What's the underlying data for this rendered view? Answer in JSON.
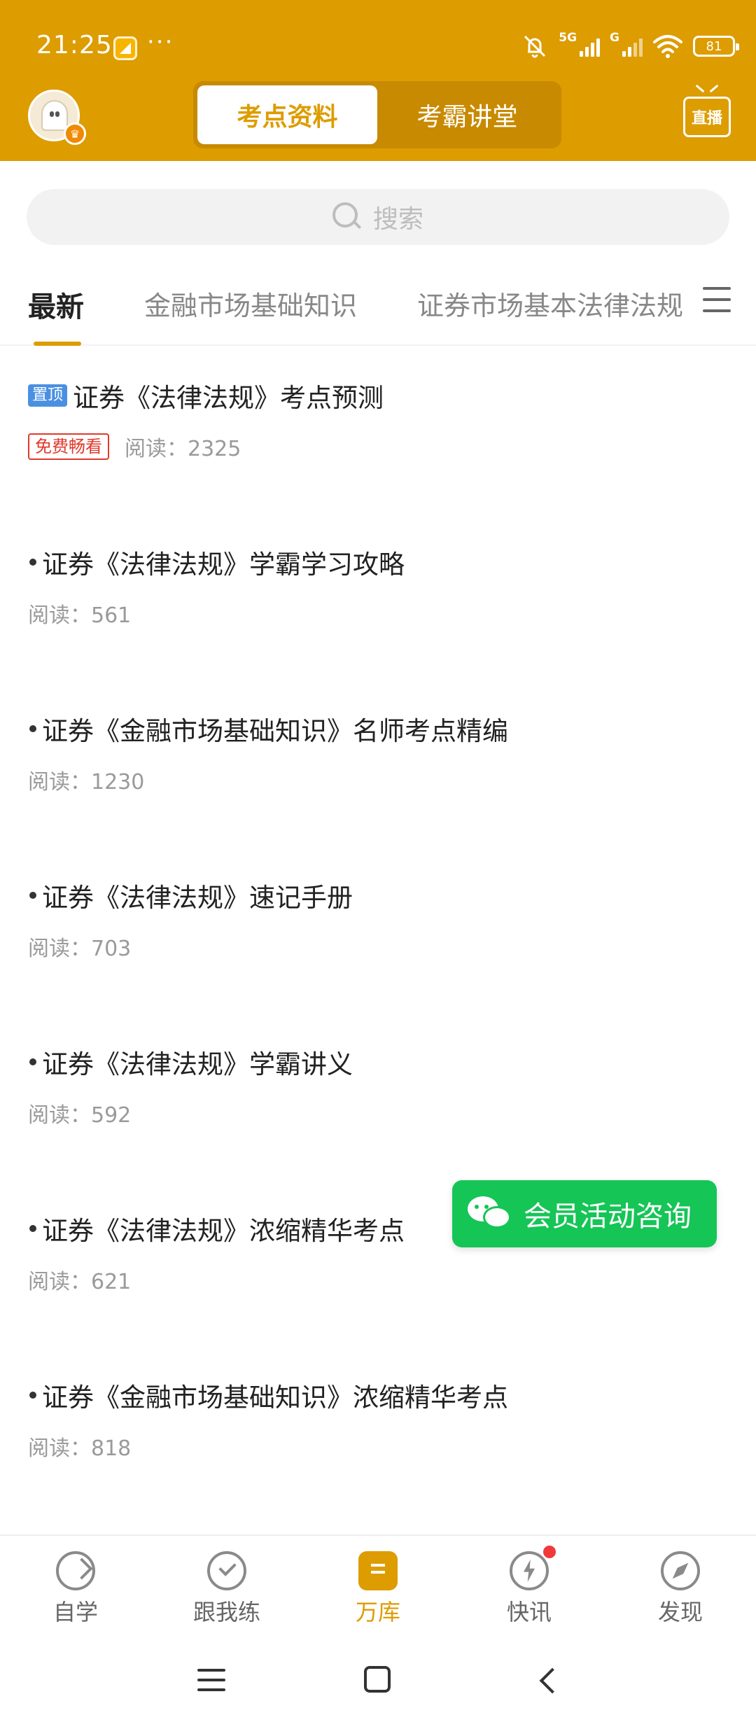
{
  "status_bar": {
    "time": "21:25",
    "more": "···",
    "signal1_label": "5G",
    "signal2_label": "G",
    "battery": "81"
  },
  "header": {
    "tabs": [
      {
        "label": "考点资料",
        "active": true
      },
      {
        "label": "考霸讲堂",
        "active": false
      }
    ],
    "live_label": "直播"
  },
  "search": {
    "placeholder": "搜索"
  },
  "category_tabs": [
    {
      "label": "最新",
      "active": true
    },
    {
      "label": "金融市场基础知识",
      "active": false
    },
    {
      "label": "证券市场基本法律法规",
      "active": false
    }
  ],
  "articles": [
    {
      "pin_tag": "置顶",
      "title": "证券《法律法规》考点预测",
      "free_tag": "免费畅看",
      "reads": "阅读：2325"
    },
    {
      "title": "证券《法律法规》学霸学习攻略",
      "reads": "阅读：561"
    },
    {
      "title": "证券《金融市场基础知识》名师考点精编",
      "reads": "阅读：1230"
    },
    {
      "title": "证券《法律法规》速记手册",
      "reads": "阅读：703"
    },
    {
      "title": "证券《法律法规》学霸讲义",
      "reads": "阅读：592"
    },
    {
      "title": "证券《法律法规》浓缩精华考点",
      "reads": "阅读：621"
    },
    {
      "title": "证券《金融市场基础知识》浓缩精华考点",
      "reads": "阅读：818"
    }
  ],
  "floating_button": {
    "label": "会员活动咨询",
    "icon": "wechat-icon"
  },
  "bottom_nav": [
    {
      "label": "自学",
      "icon": "study-icon",
      "active": false
    },
    {
      "label": "跟我练",
      "icon": "practice-icon",
      "active": false
    },
    {
      "label": "万库",
      "icon": "library-icon",
      "active": true
    },
    {
      "label": "快讯",
      "icon": "flash-icon",
      "active": false,
      "badge": true
    },
    {
      "label": "发现",
      "icon": "compass-icon",
      "active": false
    }
  ],
  "colors": {
    "brand": "#DD9C00",
    "wechat_green": "#15C556",
    "pin_blue": "#4A90E2",
    "free_red": "#E0392B",
    "badge_red": "#F03A3A"
  }
}
